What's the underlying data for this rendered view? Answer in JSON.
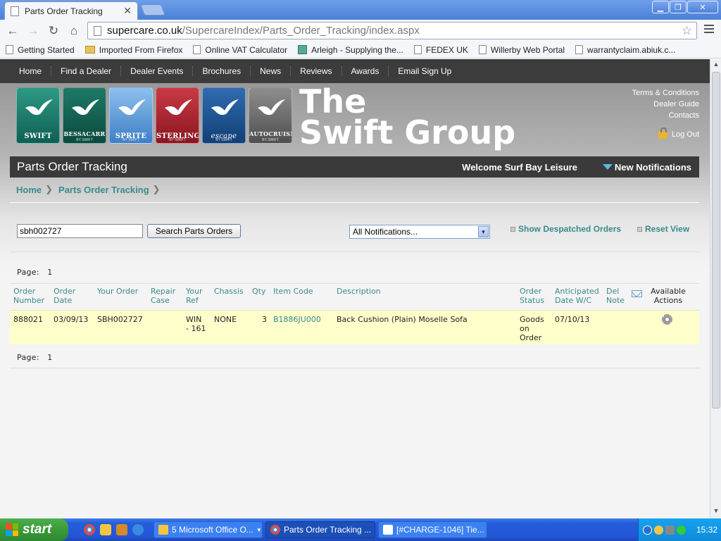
{
  "browser": {
    "tab_title": "Parts Order Tracking",
    "url_host": "supercare.co.uk",
    "url_path": "/SupercareIndex/Parts_Order_Tracking/index.aspx",
    "bookmarks": [
      {
        "label": "Getting Started",
        "icon": "page-icon"
      },
      {
        "label": "Imported From Firefox",
        "icon": "folder-icon"
      },
      {
        "label": "Online VAT Calculator",
        "icon": "page-icon"
      },
      {
        "label": "Arleigh - Supplying the...",
        "icon": "site-icon"
      },
      {
        "label": "FEDEX UK",
        "icon": "page-icon"
      },
      {
        "label": "Willerby Web Portal",
        "icon": "page-icon"
      },
      {
        "label": "warrantyclaim.abiuk.c...",
        "icon": "page-icon"
      }
    ]
  },
  "site": {
    "nav": [
      "Home",
      "Find a Dealer",
      "Dealer Events",
      "Brochures",
      "News",
      "Reviews",
      "Awards",
      "Email Sign Up"
    ],
    "brands": [
      {
        "name": "SWIFT",
        "sub": "",
        "color": "#1d7d6c"
      },
      {
        "name": "BESSACARR",
        "sub": "BY SWIFT",
        "color": "#0f5a4b"
      },
      {
        "name": "SPRITE",
        "sub": "BY SWIFT",
        "color": "#5d9bd8"
      },
      {
        "name": "STERLING",
        "sub": "BY SWIFT",
        "color": "#a8222e"
      },
      {
        "name": "escape",
        "sub": "BY SWIFT",
        "color": "#1a4f8e"
      },
      {
        "name": "AUTOCRUISE",
        "sub": "BY SWIFT",
        "color": "#6b6b6b"
      }
    ],
    "group_title_line1": "The",
    "group_title_line2": "Swift Group",
    "right_links": [
      "Terms & Conditions",
      "Dealer Guide",
      "Contacts"
    ],
    "logout": "Log Out"
  },
  "page": {
    "title": "Parts Order Tracking",
    "welcome": "Welcome Surf Bay Leisure",
    "notifications": "New Notifications",
    "breadcrumb": [
      "Home",
      "Parts Order Tracking"
    ],
    "search_value": "sbh002727",
    "search_button": "Search Parts Orders",
    "filter_selected": "All Notifications...",
    "show_despatched": "Show Despatched Orders",
    "reset_view": "Reset View",
    "page_label": "Page:",
    "page_number": "1"
  },
  "table": {
    "headers": {
      "order_number": [
        "Order",
        "Number"
      ],
      "order_date": [
        "Order",
        "Date"
      ],
      "your_order": [
        "Your Order"
      ],
      "repair_case": [
        "Repair",
        "Case"
      ],
      "your_ref": [
        "Your",
        "Ref"
      ],
      "chassis": [
        "Chassis"
      ],
      "qty": [
        "Qty"
      ],
      "item_code": [
        "Item Code"
      ],
      "description": [
        "Description"
      ],
      "order_status": [
        "Order",
        "Status"
      ],
      "anticipated": [
        "Anticipated",
        "Date W/C"
      ],
      "del_note": [
        "Del",
        "Note"
      ],
      "available_actions": [
        "Available",
        "Actions"
      ]
    },
    "rows": [
      {
        "order_number": "888021",
        "order_date": "03/09/13",
        "your_order": "SBH002727",
        "repair_case": "",
        "your_ref_1": "WIN",
        "your_ref_2": "- 161",
        "chassis": "NONE",
        "qty": "3",
        "item_code": "B1886JU000",
        "description": "Back Cushion (Plain) Moselle Sofa",
        "status_1": "Goods",
        "status_2": "on",
        "status_3": "Order",
        "anticipated": "07/10/13"
      }
    ]
  },
  "taskbar": {
    "start": "start",
    "tasks": [
      {
        "label": "5 Microsoft Office O...",
        "active": false
      },
      {
        "label": "Parts Order Tracking ...",
        "active": true
      },
      {
        "label": "[#CHARGE-1046] Tie...",
        "active": false
      }
    ],
    "clock": "15:32"
  }
}
